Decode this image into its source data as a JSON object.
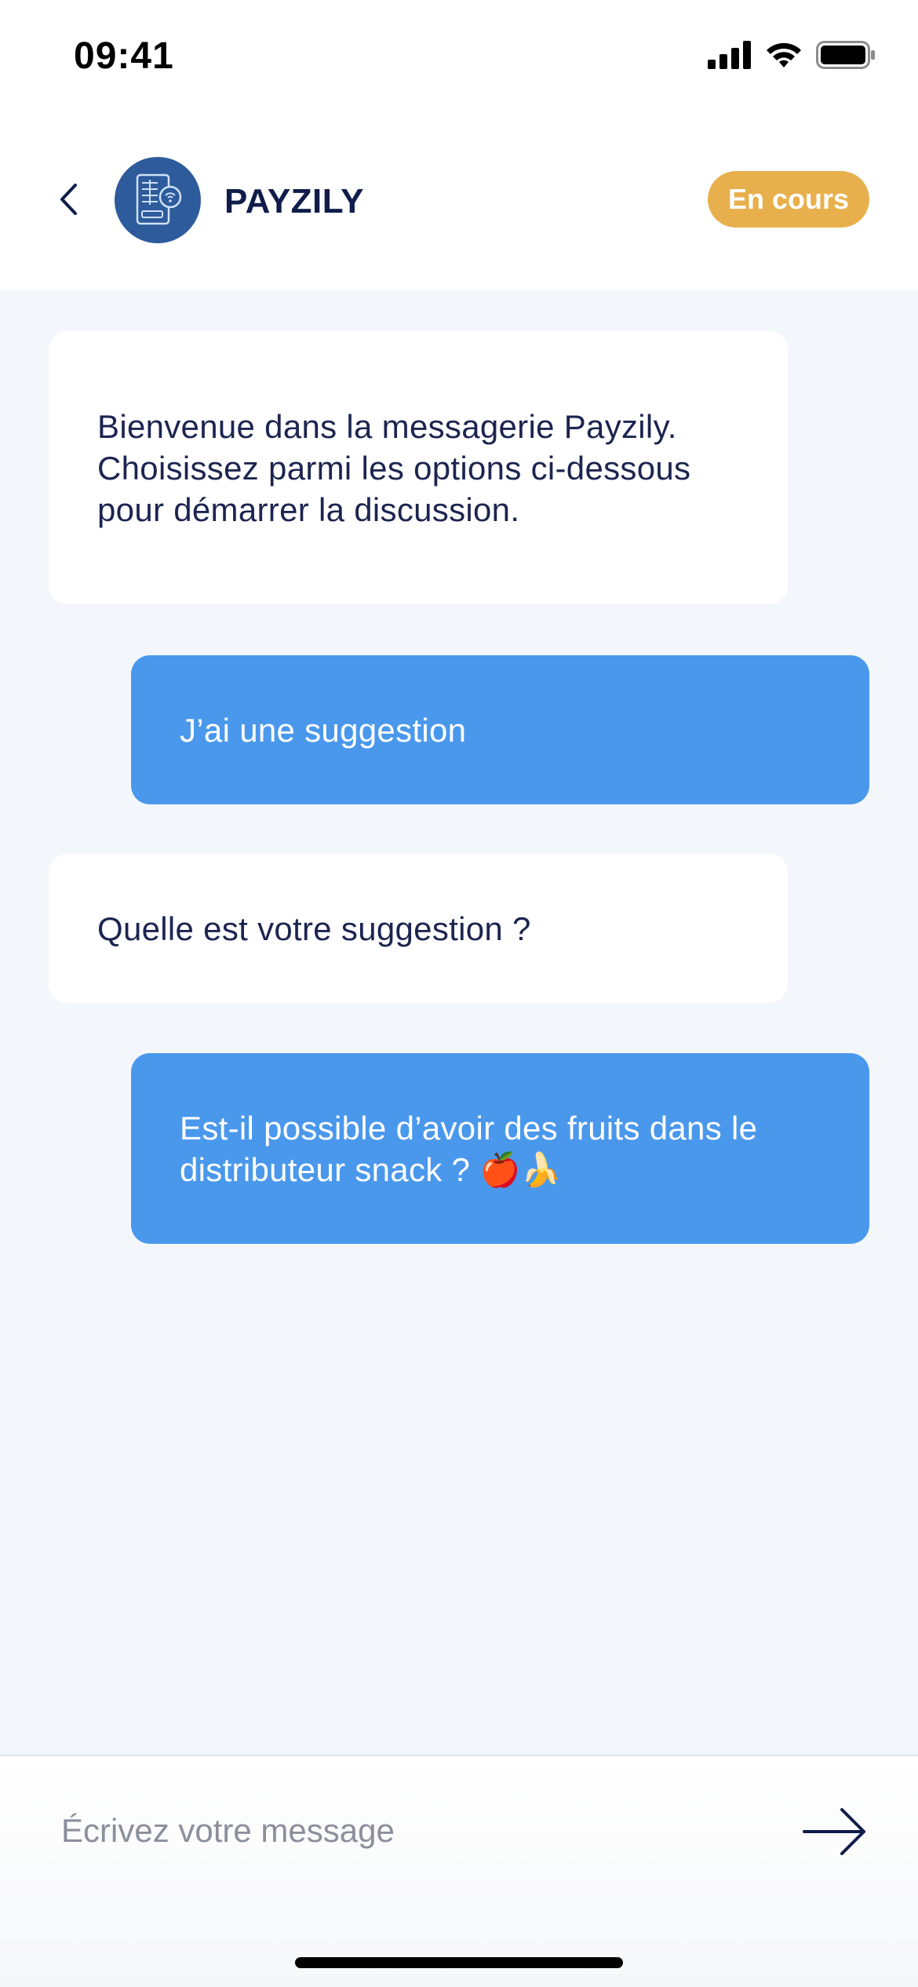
{
  "status_bar": {
    "time": "09:41",
    "icons": [
      "cellular-signal-icon",
      "wifi-icon",
      "battery-icon"
    ]
  },
  "header": {
    "back_icon": "chevron-left-icon",
    "avatar_icon": "vending-machine-icon",
    "contact_name": "PAYZILY",
    "status_badge": "En cours"
  },
  "messages": [
    {
      "sender": "bot",
      "text": "Bienvenue dans la messagerie Payzily. Choisissez parmi les options ci-dessous pour démarrer la discussion."
    },
    {
      "sender": "user",
      "text": "J’ai une suggestion"
    },
    {
      "sender": "bot",
      "text": "Quelle est votre suggestion ?"
    },
    {
      "sender": "user",
      "text": "Est-il possible d’avoir des fruits dans le distributeur snack ? 🍎🍌"
    }
  ],
  "composer": {
    "placeholder": "Écrivez votre message",
    "value": "",
    "send_icon": "arrow-right-icon"
  },
  "colors": {
    "brand_navy": "#101d4a",
    "badge_yellow": "#e8b04c",
    "user_bubble_blue": "#4a98ec",
    "chat_background": "#f3f7fb"
  }
}
